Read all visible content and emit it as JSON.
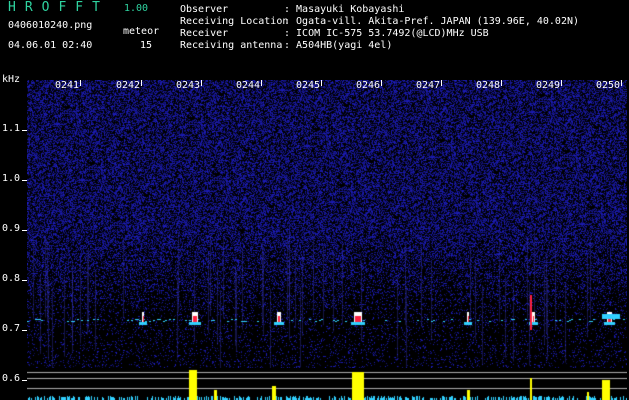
{
  "header": {
    "app_title": "HROFFT",
    "app_version": "1.00",
    "filename": "0406010240.png",
    "timestamp": "04.06.01 02:40",
    "meteor_label": "meteor",
    "meteor_count": "15"
  },
  "info": {
    "rows": [
      {
        "label": "Observer",
        "value": ": Masayuki Kobayashi"
      },
      {
        "label": "Receiving Location",
        "value": ": Ogata-vill. Akita-Pref. JAPAN (139.96E, 40.02N)"
      },
      {
        "label": "Receiver",
        "value": ": ICOM IC-575 53.7492(@LCD)MHz USB"
      },
      {
        "label": "Receiving antenna",
        "value": ": A504HB(yagi 4el)"
      }
    ]
  },
  "axis": {
    "unit": "kHz",
    "y_ticks": [
      "1.1",
      "1.0",
      "0.9",
      "0.8",
      "0.7",
      "0.6"
    ],
    "time_ticks": [
      "0241",
      "0242",
      "0243",
      "0244",
      "0245",
      "0246",
      "0247",
      "0248",
      "0249",
      "0250"
    ]
  },
  "colors": {
    "background": "#000000",
    "noise": "#1a1aa0",
    "signal_red": "#ff2040",
    "signal_white": "#ffffff",
    "echo_cyan": "#30d0ff",
    "bar_yellow": "#ffff00",
    "title_green": "#2fd3a0"
  }
}
